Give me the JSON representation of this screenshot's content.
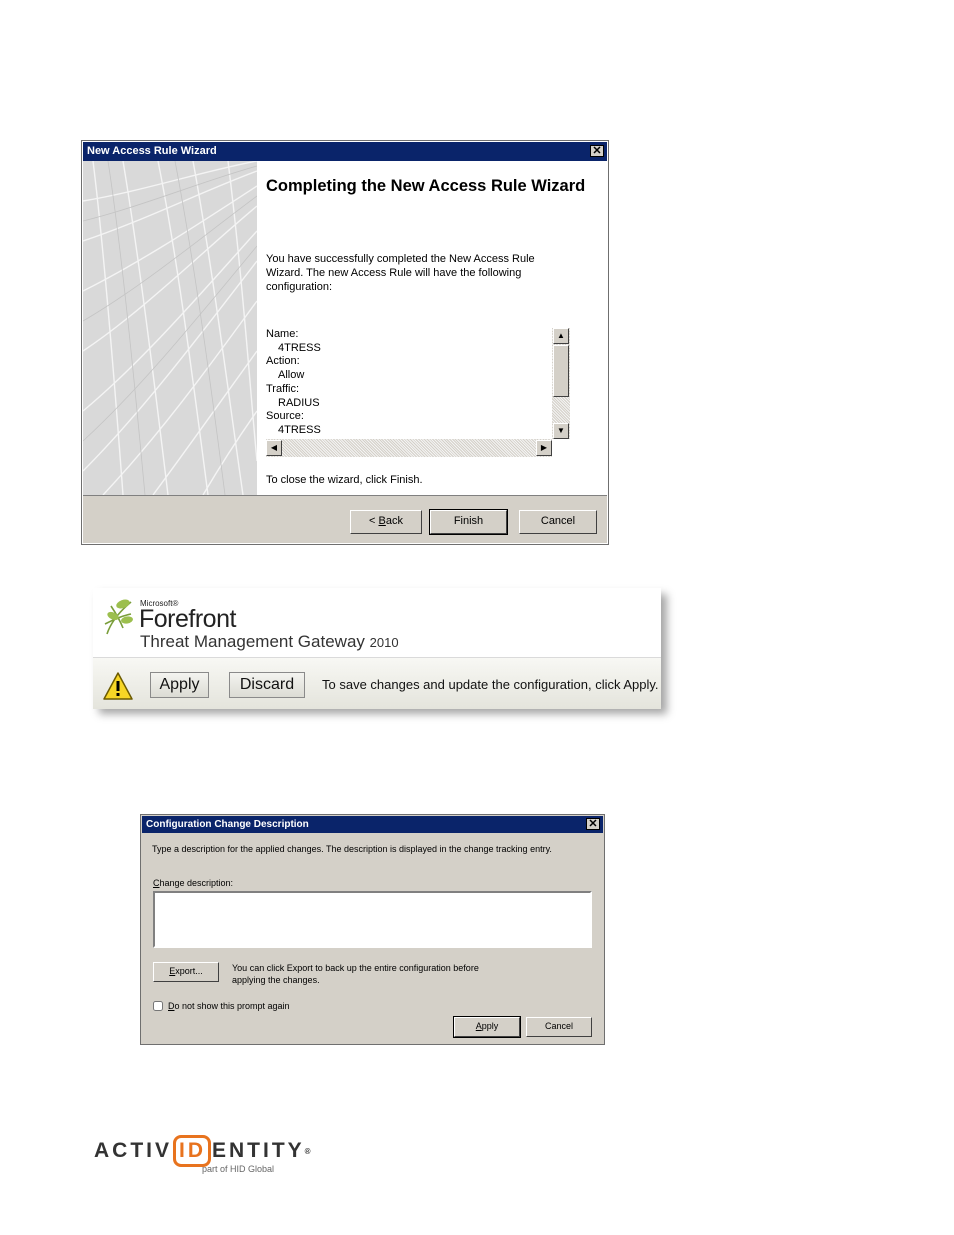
{
  "wizard": {
    "title": "New Access Rule Wizard",
    "heading": "Completing the New Access Rule Wizard",
    "description": "You have successfully completed the New Access Rule Wizard. The new Access Rule will have the following configuration:",
    "summary": [
      {
        "text": "Name:",
        "indent": false
      },
      {
        "text": "4TRESS",
        "indent": true
      },
      {
        "text": "Action:",
        "indent": false
      },
      {
        "text": "Allow",
        "indent": true
      },
      {
        "text": "Traffic:",
        "indent": false
      },
      {
        "text": "RADIUS",
        "indent": true
      },
      {
        "text": "Source:",
        "indent": false
      },
      {
        "text": "4TRESS",
        "indent": true
      }
    ],
    "close_note": "To close the wizard, click Finish.",
    "back_label_prefix": "< ",
    "back_label_mnemonic": "B",
    "back_label_rest": "ack",
    "finish_label": "Finish",
    "cancel_label": "Cancel"
  },
  "banner": {
    "microsoft": "Microsoft®",
    "product": "Forefront",
    "product_line": "Threat Management Gateway",
    "year": "2010",
    "apply_label": "Apply",
    "discard_label": "Discard",
    "note": "To save changes and update the configuration, click Apply."
  },
  "config_dialog": {
    "title": "Configuration Change Description",
    "description": "Type a description for the applied changes. The description is displayed in the change tracking entry.",
    "change_label_mnemonic": "C",
    "change_label_rest": "hange description:",
    "change_value": "",
    "export_mnemonic": "E",
    "export_rest": "xport...",
    "export_hint": "You can click Export to back up the entire configuration before applying the changes.",
    "dont_show_mnemonic": "D",
    "dont_show_rest": "o not show this prompt again",
    "apply_mnemonic": "A",
    "apply_rest": "pply",
    "cancel_label": "Cancel"
  },
  "brand": {
    "left": "ACTIV",
    "id": "ID",
    "right": "ENTITY",
    "reg": "®",
    "tagline": "part of HID Global"
  },
  "colors": {
    "titlebar": "#0a246a",
    "dialog_face": "#d4d0c8",
    "brand_orange": "#e8731e"
  }
}
